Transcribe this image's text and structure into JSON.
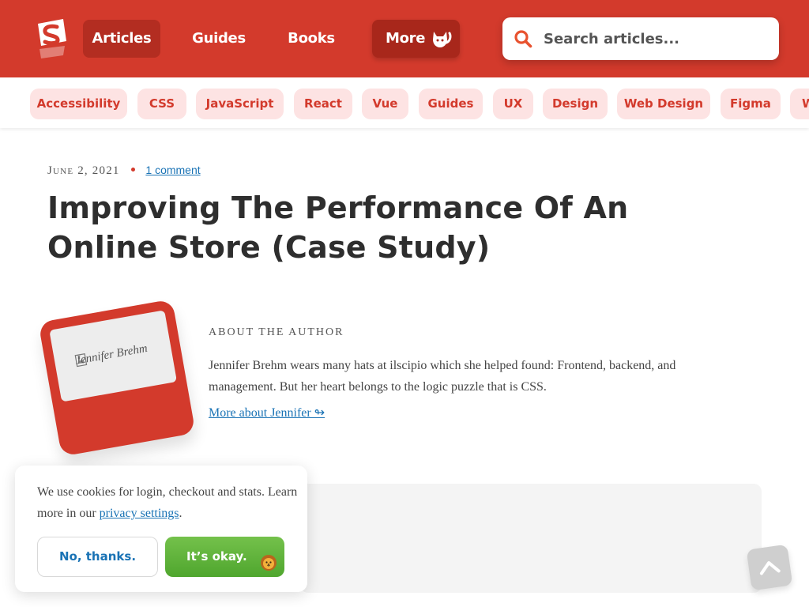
{
  "header": {
    "nav": [
      {
        "label": "Articles"
      },
      {
        "label": "Guides"
      },
      {
        "label": "Books"
      },
      {
        "label": "More"
      }
    ],
    "search_placeholder": "Search articles..."
  },
  "tags": [
    "Accessibility",
    "CSS",
    "JavaScript",
    "React",
    "Vue",
    "Guides",
    "UX",
    "Design",
    "Web Design",
    "Figma",
    "W"
  ],
  "article": {
    "date": "June 2, 2021",
    "comments": "1 comment",
    "title": "Improving The Performance Of An Online Store (Case Study)"
  },
  "author": {
    "image_alt": "Jennifer Brehm",
    "heading": "About The Author",
    "bio": "Jennifer Brehm wears many hats at ilscipio which she helped found: Frontend, backend, and management. But her heart belongs to the logic puzzle that is CSS.",
    "link": "More about Jennifer ↬"
  },
  "cookie": {
    "text_before": "We use cookies for login, checkout and stats. Learn more in our ",
    "link": "privacy settings",
    "text_after": ".",
    "decline": "No, thanks.",
    "accept": "It’s okay."
  },
  "colors": {
    "brand": "#d33a2c",
    "tag_bg": "#fde3e3",
    "link": "#1a73b5",
    "accept_green": "#5cb23a"
  },
  "icons": [
    "smashing-logo-icon",
    "cat-icon",
    "search-icon",
    "image-icon",
    "lion-emoji-icon",
    "chevron-up-icon"
  ]
}
